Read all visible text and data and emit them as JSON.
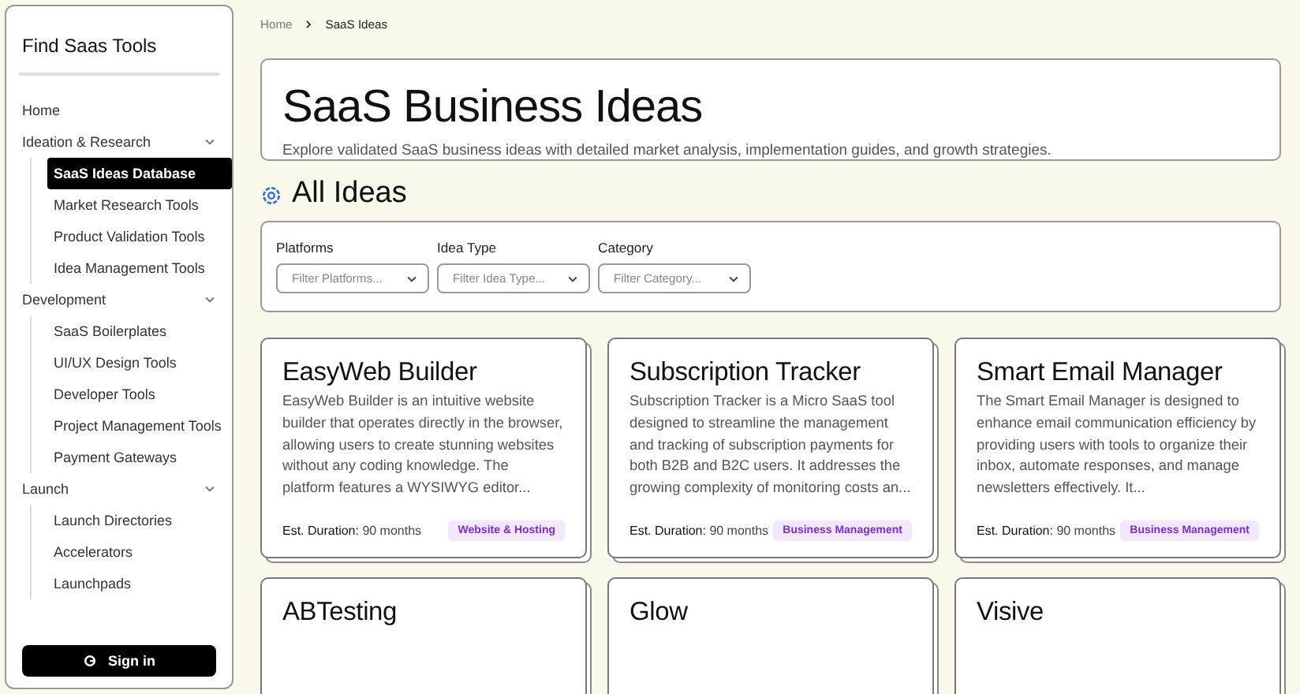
{
  "sidebar": {
    "title": "Find Saas Tools",
    "items": [
      {
        "label": "Home",
        "selected": false
      },
      {
        "label": "Ideation & Research",
        "expanded": true,
        "selected": false,
        "children": [
          {
            "label": "SaaS Ideas Database",
            "selected": true
          },
          {
            "label": "Market Research Tools",
            "selected": false
          },
          {
            "label": "Product Validation Tools",
            "selected": false
          },
          {
            "label": "Idea Management Tools",
            "selected": false
          }
        ]
      },
      {
        "label": "Development",
        "expanded": true,
        "selected": false,
        "children": [
          {
            "label": "SaaS Boilerplates",
            "selected": false
          },
          {
            "label": "UI/UX Design Tools",
            "selected": false
          },
          {
            "label": "Developer Tools",
            "selected": false
          },
          {
            "label": "Project Management Tools",
            "selected": false
          },
          {
            "label": "Payment Gateways",
            "selected": false
          }
        ]
      },
      {
        "label": "Launch",
        "expanded": true,
        "selected": false,
        "children": [
          {
            "label": "Launch Directories",
            "selected": false
          },
          {
            "label": "Accelerators",
            "selected": false
          },
          {
            "label": "Launchpads",
            "selected": false
          }
        ]
      }
    ],
    "sign_in": "Sign in"
  },
  "breadcrumb": [
    "Home",
    "SaaS Ideas"
  ],
  "header": {
    "title": "SaaS Business Ideas",
    "subtitle": "Explore validated SaaS business ideas with detailed market analysis, implementation guides, and growth strategies."
  },
  "section_title": "All Ideas",
  "filters": [
    {
      "label": "Platforms",
      "placeholder": "Filter Platforms..."
    },
    {
      "label": "Idea Type",
      "placeholder": "Filter Idea Type..."
    },
    {
      "label": "Category",
      "placeholder": "Filter Category..."
    }
  ],
  "ideas": [
    {
      "title": "EasyWeb Builder",
      "description": "EasyWeb Builder is an intuitive website builder that operates directly in the browser, allowing users to create stunning websites without any coding knowledge. The platform features a WYSIWYG editor...",
      "duration_label": "Est. Duration:",
      "duration": "90 months",
      "tag": "Website & Hosting"
    },
    {
      "title": "Subscription Tracker",
      "description": "Subscription Tracker is a Micro SaaS tool designed to streamline the management and tracking of subscription payments for both B2B and B2C users. It addresses the growing complexity of monitoring costs an...",
      "duration_label": "Est. Duration:",
      "duration": "90 months",
      "tag": "Business Management"
    },
    {
      "title": "Smart Email Manager",
      "description": "The Smart Email Manager is designed to enhance email communication efficiency by providing users with tools to organize their inbox, automate responses, and manage newsletters effectively. It...",
      "duration_label": "Est. Duration:",
      "duration": "90 months",
      "tag": "Business Management"
    },
    {
      "title": "ABTesting"
    },
    {
      "title": "Glow"
    },
    {
      "title": "Visive"
    }
  ]
}
